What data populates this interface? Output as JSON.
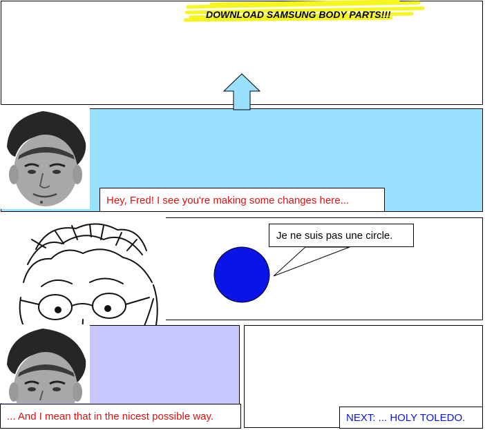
{
  "panel1": {
    "banner_text": "DOWNLOAD SAMSUNG BODY PARTS!!!",
    "highlight_color": "#f5f51f"
  },
  "panel2": {
    "caption": "Hey, Fred!  I see you're making some changes here...",
    "caption_color": "#e01010",
    "background_color": "#99e1ff"
  },
  "panel3": {
    "speech": "Je ne suis pas une circle.",
    "circle_color": "#0a14e6"
  },
  "panel4": {
    "caption": "... And I mean that in the nicest possible way.",
    "caption_color": "#e01010",
    "background_color": "#c8c8ff"
  },
  "panel5": {
    "next_link": "NEXT: ... HOLY TOLEDO.",
    "link_color": "#0a14e6"
  }
}
